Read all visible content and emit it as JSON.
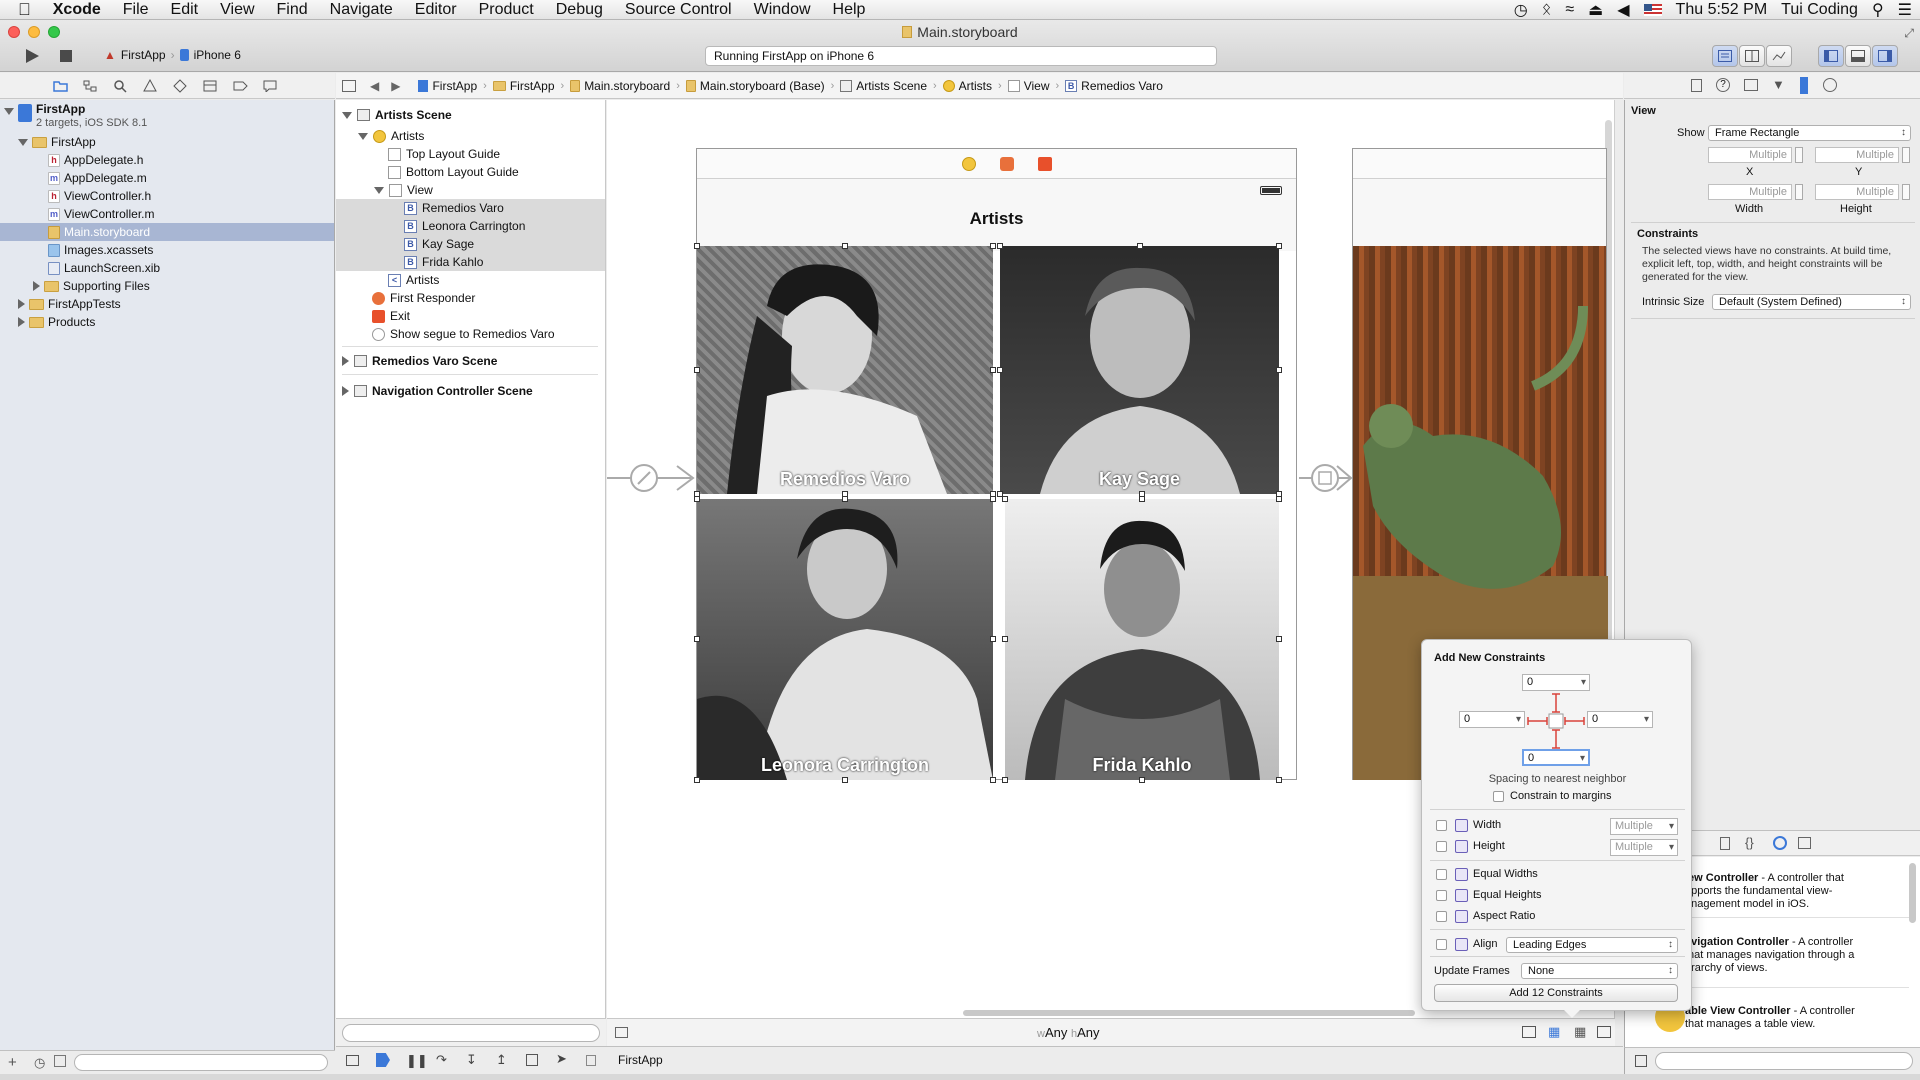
{
  "menubar": {
    "apple": "",
    "items": [
      "Xcode",
      "File",
      "Edit",
      "View",
      "Find",
      "Navigate",
      "Editor",
      "Product",
      "Debug",
      "Source Control",
      "Window",
      "Help"
    ],
    "clock": "Thu 5:52 PM",
    "user": "Tui Coding"
  },
  "toolbar": {
    "window_title": "Main.storyboard",
    "scheme": "FirstApp",
    "device": "iPhone 6",
    "activity": "Running FirstApp on iPhone 6"
  },
  "navigator": {
    "project": "FirstApp",
    "project_sub": "2 targets, iOS SDK 8.1",
    "group": "FirstApp",
    "files": [
      {
        "name": "AppDelegate.h",
        "kind": "h"
      },
      {
        "name": "AppDelegate.m",
        "kind": "m"
      },
      {
        "name": "ViewController.h",
        "kind": "h"
      },
      {
        "name": "ViewController.m",
        "kind": "m"
      },
      {
        "name": "Main.storyboard",
        "kind": "storyboard"
      },
      {
        "name": "Images.xcassets",
        "kind": "xcassets"
      },
      {
        "name": "LaunchScreen.xib",
        "kind": "xib"
      }
    ],
    "supporting": "Supporting Files",
    "tests": "FirstAppTests",
    "products": "Products"
  },
  "jumpbar": [
    "FirstApp",
    "FirstApp",
    "Main.storyboard",
    "Main.storyboard (Base)",
    "Artists Scene",
    "Artists",
    "View",
    "Remedios Varo"
  ],
  "outline": {
    "scene1": "Artists Scene",
    "vc": "Artists",
    "top_guide": "Top Layout Guide",
    "bottom_guide": "Bottom Layout Guide",
    "view": "View",
    "images": [
      "Remedios Varo",
      "Leonora Carrington",
      "Kay Sage",
      "Frida Kahlo"
    ],
    "nav_item": "Artists",
    "responder": "First Responder",
    "exit": "Exit",
    "segue": "Show segue to Remedios Varo",
    "scene2": "Remedios Varo Scene",
    "scene3": "Navigation Controller Scene"
  },
  "canvas": {
    "nav_title": "Artists",
    "captions": [
      "Remedios Varo",
      "Kay Sage",
      "Leonora Carrington",
      "Frida Kahlo"
    ],
    "size_w": "wAny",
    "size_h": "hAny"
  },
  "inspector": {
    "section": "View",
    "show_label": "Show",
    "show_value": "Frame Rectangle",
    "multiple": "Multiple",
    "x": "X",
    "y": "Y",
    "width": "Width",
    "height": "Height",
    "constraints_title": "Constraints",
    "constraints_text": "The selected views have no constraints. At build time, explicit left, top, width, and height constraints will be generated for the view.",
    "intrinsic_label": "Intrinsic Size",
    "intrinsic_value": "Default (System Defined)"
  },
  "library": [
    {
      "title": "View Controller",
      "desc": " - A controller that supports the fundamental view-management model in iOS.",
      "shown_title": "iew Controller",
      "shown_desc": " - A controller that",
      "line2": "upports the fundamental view-",
      "line3": "anagement model in iOS."
    },
    {
      "title": "Navigation Controller",
      "shown_title": "avigation Controller",
      "shown_desc": " - A controller",
      "line2": "that manages navigation through a",
      "line3": "erarchy of views."
    },
    {
      "title": "Table View Controller",
      "shown_title": "able View Controller",
      "shown_desc": " - A controller",
      "line2": "that manages a table view."
    }
  ],
  "popover": {
    "title": "Add New Constraints",
    "top": "0",
    "left": "0",
    "right": "0",
    "bottom": "0",
    "spacing_label": "Spacing to nearest neighbor",
    "constrain_margins": "Constrain to margins",
    "width": "Width",
    "height": "Height",
    "multiple": "Multiple",
    "equal_widths": "Equal Widths",
    "equal_heights": "Equal Heights",
    "aspect_ratio": "Aspect Ratio",
    "align": "Align",
    "align_value": "Leading Edges",
    "update_frames": "Update Frames",
    "update_value": "None",
    "add_button": "Add 12 Constraints"
  },
  "debugbar": {
    "target": "FirstApp"
  },
  "colors": {
    "selection": "#a8b6d3",
    "accent": "#3b78d8",
    "constraint_red": "#d9433b"
  }
}
